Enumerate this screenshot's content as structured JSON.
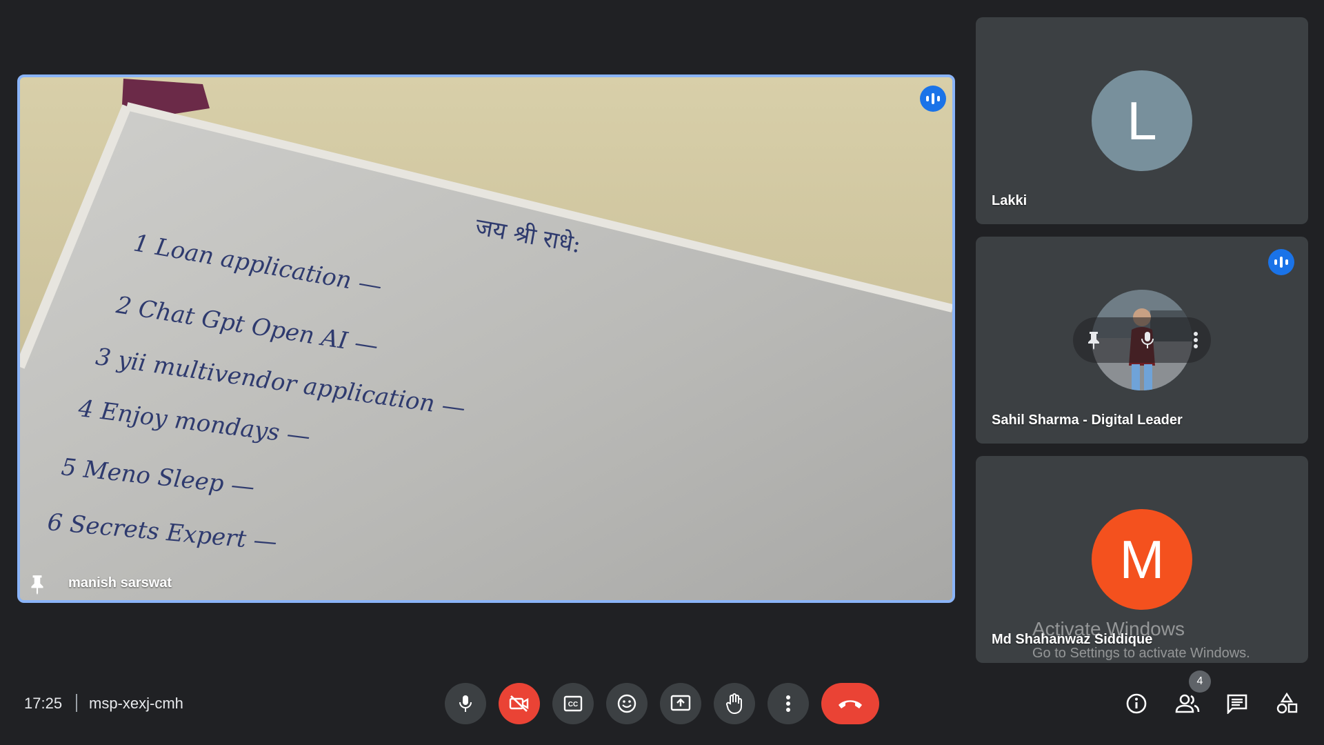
{
  "main_tile": {
    "participant_name": "manish sarswat",
    "speaking": true,
    "pinned": true,
    "whiteboard": {
      "header": "जय श्री राधे:",
      "items": [
        "1 Loan application —",
        "2 Chat Gpt Open AI —",
        "3 yii multivendor application —",
        "4 Enjoy mondays —",
        "5 Meno Sleep —",
        "6 Secrets Expert —"
      ]
    }
  },
  "side_tiles": [
    {
      "name": "Lakki",
      "avatar_letter": "L",
      "avatar_color": "#78909c"
    },
    {
      "name": "Sahil Sharma - Digital Leader",
      "avatar_letter": "",
      "speaking": true
    },
    {
      "name": "Md Shahanwaz Siddique",
      "avatar_letter": "M",
      "avatar_color": "#f4511e"
    }
  ],
  "watermark": {
    "title": "Activate Windows",
    "subtitle": "Go to Settings to activate Windows."
  },
  "bottom_bar": {
    "time": "17:25",
    "meeting_code": "msp-xexj-cmh",
    "people_count": "4",
    "controls": [
      "microphone",
      "camera-off",
      "captions",
      "reactions",
      "present-screen",
      "raise-hand",
      "more-options",
      "leave-call"
    ],
    "right_controls": [
      "meeting-details",
      "people",
      "chat",
      "activities"
    ]
  }
}
